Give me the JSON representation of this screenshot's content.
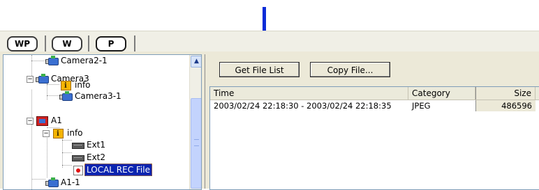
{
  "tabs": [
    "WP",
    "W",
    "P"
  ],
  "tree": {
    "nodes": [
      {
        "label": "Camera2-1",
        "icon": "camera-icon"
      },
      {
        "label": "Camera3",
        "icon": "camera-icon",
        "expander": "−"
      },
      {
        "label": "info",
        "icon": "info-folder-icon"
      },
      {
        "label": "Camera3-1",
        "icon": "camera-icon"
      },
      {
        "label": "A1",
        "icon": "a1-device-icon",
        "expander": "−"
      },
      {
        "label": "info",
        "icon": "info-folder-icon",
        "expander": "−"
      },
      {
        "label": "Ext1",
        "icon": "ext-port-icon"
      },
      {
        "label": "Ext2",
        "icon": "ext-port-icon"
      },
      {
        "label": "LOCAL REC File",
        "icon": "rec-file-icon",
        "selected": true
      },
      {
        "label": "A1-1",
        "icon": "camera-icon"
      }
    ],
    "scroll_up_glyph": "▲"
  },
  "toolbar": {
    "get_file_list": "Get File List",
    "copy_file": "Copy File..."
  },
  "file_list": {
    "columns": [
      "Time",
      "Category",
      "Size"
    ],
    "rows": [
      [
        "2003/02/24 22:18:30 - 2003/02/24 22:18:35",
        "JPEG",
        "486596"
      ]
    ]
  },
  "colors": {
    "pointer_arrow": "#0a2cd8",
    "selection": "#0a24b0"
  }
}
